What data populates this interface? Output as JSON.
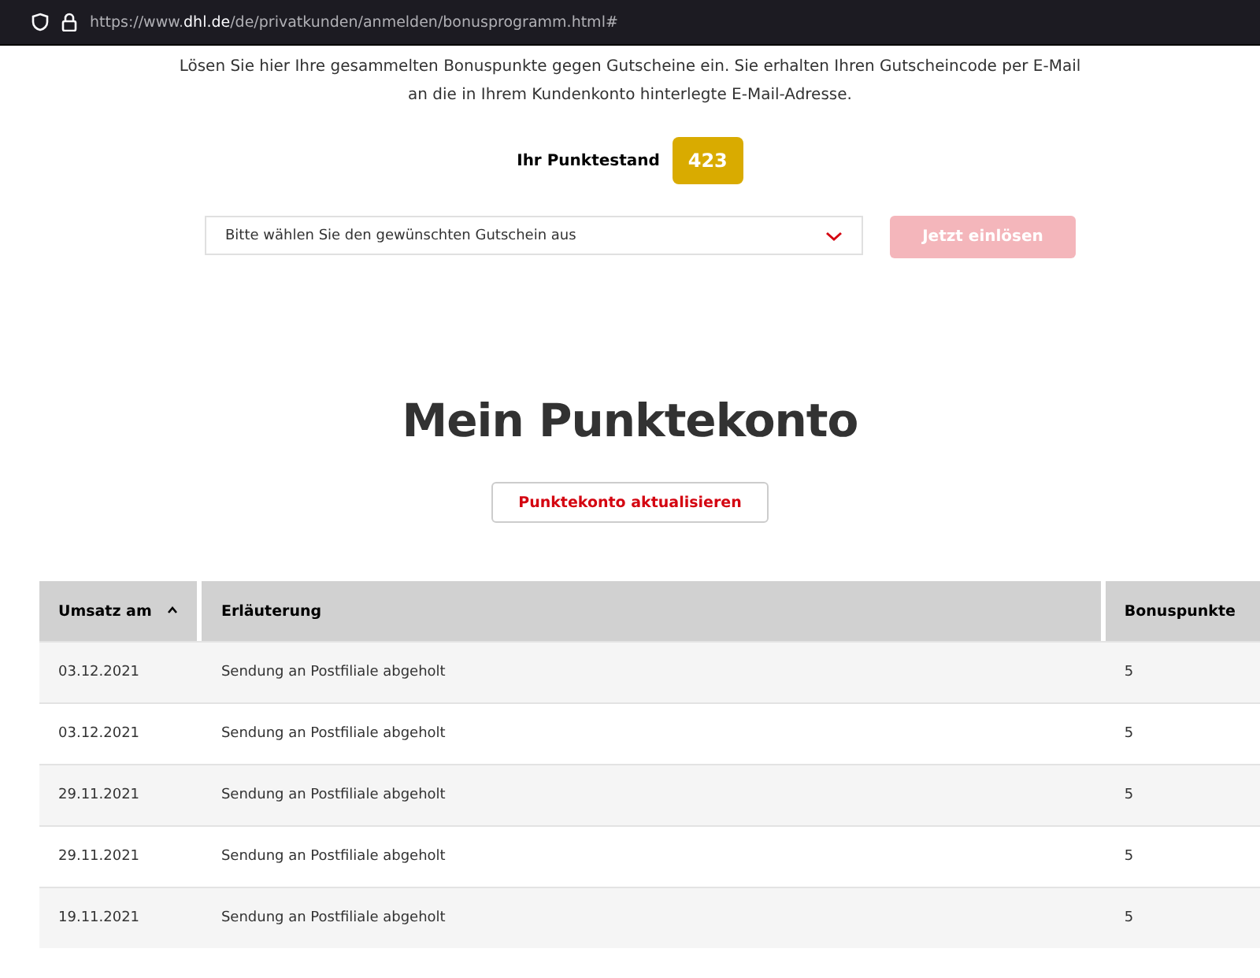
{
  "browser": {
    "url_prefix": "https://www.",
    "url_domain": "dhl.de",
    "url_path": "/de/privatkunden/anmelden/bonusprogramm.html#"
  },
  "intro": {
    "lines": [
      "Lösen Sie hier Ihre gesammelten Bonuspunkte gegen Gutscheine ein. Sie erhalten Ihren Gutscheincode per E-Mail",
      "an die in Ihrem Kundenkonto hinterlegte E-Mail-Adresse."
    ]
  },
  "points": {
    "label": "Ihr Punktestand",
    "value": "423"
  },
  "voucher_select": {
    "placeholder": "Bitte wählen Sie den gewünschten Gutschein aus"
  },
  "redeem_button": {
    "label": "Jetzt einlösen",
    "disabled": true
  },
  "heading": "Mein Punktekonto",
  "refresh_button": {
    "label": "Punktekonto aktualisieren"
  },
  "table": {
    "columns": [
      {
        "label": "Umsatz am",
        "sorted": true
      },
      {
        "label": "Erläuterung",
        "sorted": false
      },
      {
        "label": "Bonuspunkte",
        "sorted": false
      }
    ],
    "rows": [
      [
        "03.12.2021",
        "Sendung an Postfiliale abgeholt",
        "5"
      ],
      [
        "03.12.2021",
        "Sendung an Postfiliale abgeholt",
        "5"
      ],
      [
        "29.11.2021",
        "Sendung an Postfiliale abgeholt",
        "5"
      ],
      [
        "29.11.2021",
        "Sendung an Postfiliale abgeholt",
        "5"
      ],
      [
        "19.11.2021",
        "Sendung an Postfiliale abgeholt",
        "5"
      ]
    ]
  }
}
